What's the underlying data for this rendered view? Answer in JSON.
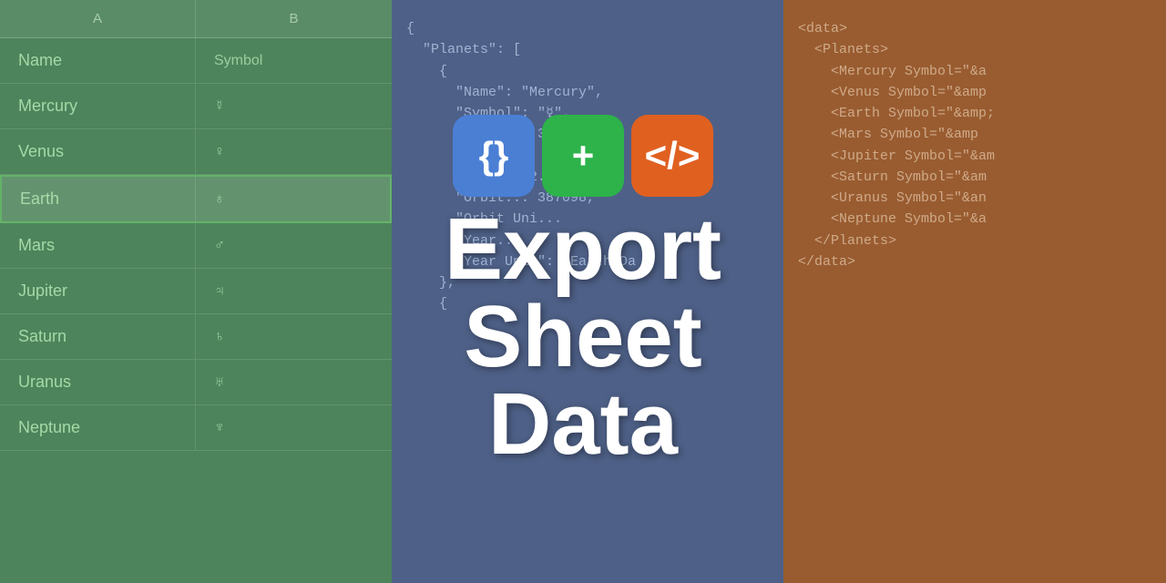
{
  "title": "Export Sheet Data",
  "panels": {
    "spreadsheet": {
      "headers": [
        "A",
        "B"
      ],
      "col_labels": [
        "Name",
        "Symbol"
      ],
      "rows": [
        {
          "name": "Mercury",
          "symbol": "&#9791;"
        },
        {
          "name": "Venus",
          "symbol": "&#9792;"
        },
        {
          "name": "Earth",
          "symbol": "&#9793;",
          "selected": true
        },
        {
          "name": "Mars",
          "symbol": "&#9794;"
        },
        {
          "name": "Jupiter",
          "symbol": "&#9795;"
        },
        {
          "name": "Saturn",
          "symbol": "&#9796;"
        },
        {
          "name": "Uranus",
          "symbol": "&#9797;"
        },
        {
          "name": "Neptune",
          "symbol": "&#9798;"
        }
      ]
    },
    "json_content": "{\n  \"Planets\": [\n    {\n      \"Name\": \"Mercury\",\n      \"Symbol\": \"&#9791;\",\n      \"Mass\": 3.3011e+24,\n      \"Mass ...\n      \"Radi... 2.3797,\n      \"Orbit... 387098,\n      \"Orbit Uni...\n      \"Year...\n      \"Year Unit\": \"Earth Da\n    },\n    {",
    "xml_content": "<data>\n  <Planets>\n    <Mercury Symbol=\"&am\n    <Venus Symbol=\"&amp\n    <Earth Symbol=\"&amp;\n    <Mars Symbol=\"&amp\n    <Jupiter Symbol=\"&am\n    <Saturn Symbol=\"&am\n    <Uranus Symbol=\"&an\n    <Neptune Symbol=\"&a\n  </Planets>\n</data>"
  },
  "icons": {
    "json_label": "{}",
    "plus_label": "+",
    "xml_label": "</>",
    "json_aria": "JSON icon",
    "plus_aria": "plus icon",
    "xml_aria": "XML icon"
  },
  "title_line1": "Export",
  "title_line2": "Sheet",
  "title_line3": "Data"
}
